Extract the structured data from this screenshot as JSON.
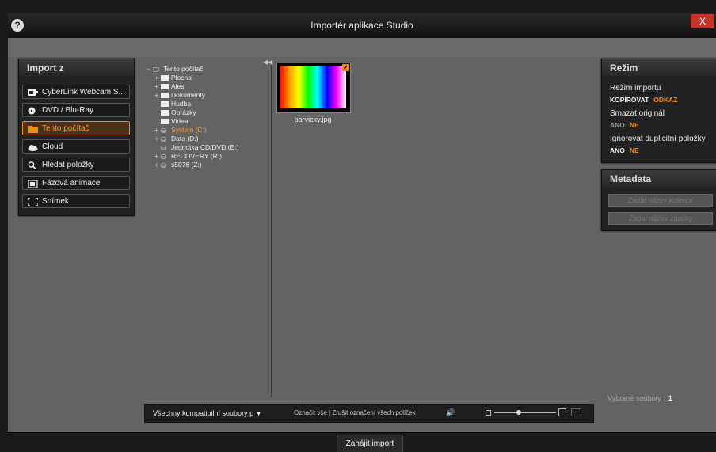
{
  "window": {
    "title": "Importér aplikace Studio",
    "close_label": "X",
    "help_label": "?"
  },
  "import_from": {
    "heading": "Import z",
    "sources": [
      {
        "label": "CyberLink Webcam S...",
        "icon": "webcam-icon"
      },
      {
        "label": "DVD / Blu-Ray",
        "icon": "disc-icon"
      },
      {
        "label": "Tento počítač",
        "icon": "folder-icon",
        "active": true
      },
      {
        "label": "Cloud",
        "icon": "cloud-icon"
      },
      {
        "label": "Hledat položky",
        "icon": "search-icon"
      },
      {
        "label": "Fázová animace",
        "icon": "camera-icon"
      },
      {
        "label": "Snímek",
        "icon": "snapshot-icon"
      }
    ]
  },
  "tree": {
    "root": "Tento počítač",
    "items": [
      {
        "label": "Plocha",
        "type": "folder"
      },
      {
        "label": "Ales",
        "type": "folder"
      },
      {
        "label": "Dokumenty",
        "type": "folder"
      },
      {
        "label": "Hudba",
        "type": "folder"
      },
      {
        "label": "Obrázky",
        "type": "folder"
      },
      {
        "label": "Videa",
        "type": "folder"
      },
      {
        "label": "System (C:)",
        "type": "drive",
        "selected": true
      },
      {
        "label": "Data (D:)",
        "type": "drive"
      },
      {
        "label": "Jednotka CD/DVD (E:)",
        "type": "drive"
      },
      {
        "label": "RECOVERY (R:)",
        "type": "drive"
      },
      {
        "label": "s5076 (Z:)",
        "type": "drive"
      }
    ]
  },
  "files": [
    {
      "name": "barvicky.jpg",
      "checked": true
    }
  ],
  "mode_panel": {
    "heading": "Režim",
    "import_mode_label": "Režim importu",
    "import_mode_options": [
      "KOPÍROVAT",
      "ODKAZ"
    ],
    "import_mode_selected": "ODKAZ",
    "delete_original_label": "Smazat originál",
    "delete_original_options": [
      "ANO",
      "NE"
    ],
    "delete_original_selected": "NE",
    "ignore_duplicates_label": "Ignorovat duplicitní položky",
    "ignore_duplicates_options": [
      "ANO",
      "NE"
    ],
    "ignore_duplicates_selected": "NE"
  },
  "metadata_panel": {
    "heading": "Metadata",
    "collection_placeholder": "Zadat název kolekce",
    "tag_placeholder": "Zadat název značky"
  },
  "selection": {
    "label": "Vybrané soubory :",
    "count": "1"
  },
  "toolbar": {
    "filter_label": "Všechny kompatibilní soubory p",
    "select_all": "Označit vše",
    "separator": "|",
    "deselect_all": "Zrušit označení všech políček",
    "zoom_level": 0.4
  },
  "footer": {
    "start_import_label": "Zahájit import"
  },
  "colors": {
    "accent": "#f08a1c",
    "background": "#636363",
    "panel": "#222222"
  }
}
